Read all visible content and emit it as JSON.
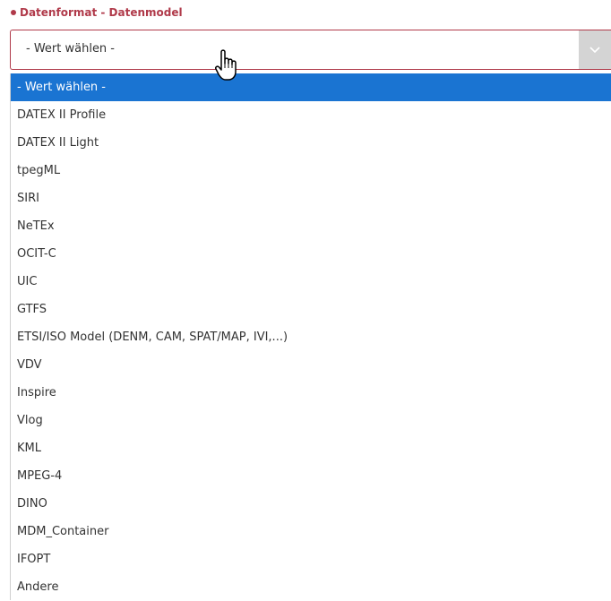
{
  "field": {
    "label": "Datenformat - Datenmodel",
    "selected_value": "- Wert wählen -"
  },
  "dropdown": {
    "options": [
      "- Wert wählen -",
      "DATEX II Profile",
      "DATEX II Light",
      "tpegML",
      "SIRI",
      "NeTEx",
      "OCIT-C",
      "UIC",
      "GTFS",
      "ETSI/ISO Model (DENM, CAM, SPAT/MAP, IVI,...)",
      "VDV",
      "Inspire",
      "Vlog",
      "KML",
      "MPEG-4",
      "DINO",
      "MDM_Container",
      "IFOPT",
      "Andere"
    ],
    "highlighted_index": 0
  },
  "colors": {
    "label": "#b03a4a",
    "highlight": "#1a74d2",
    "arrow_bg": "#d4d4d4"
  }
}
